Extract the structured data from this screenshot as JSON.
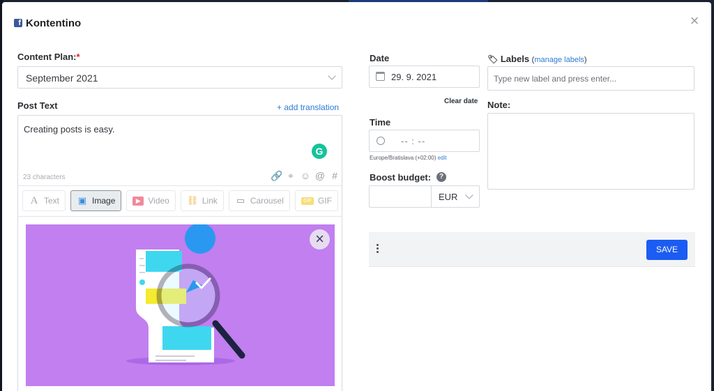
{
  "header": {
    "title": "Kontentino",
    "network_icon": "facebook-icon",
    "close_icon": "×"
  },
  "content_plan": {
    "label": "Content Plan:",
    "required_mark": "*",
    "value": "September 2021"
  },
  "post_text": {
    "label": "Post Text",
    "add_translation": "+ add translation",
    "value": "Creating posts is easy.",
    "char_count": "23 characters",
    "grammarly_letter": "G",
    "toolbar_icons": [
      "link-icon",
      "target-icon",
      "emoji-icon",
      "at-icon",
      "hashtag-icon"
    ]
  },
  "media_tabs": [
    {
      "label": "Text",
      "icon": "A",
      "active": false
    },
    {
      "label": "Image",
      "icon": "▣",
      "active": true
    },
    {
      "label": "Video",
      "icon": "▶",
      "active": false
    },
    {
      "label": "Link",
      "icon": "⛓",
      "active": false
    },
    {
      "label": "Carousel",
      "icon": "▭",
      "active": false
    },
    {
      "label": "GIF",
      "icon": "GIF",
      "active": false
    }
  ],
  "image_preview": {
    "remove_icon": "×"
  },
  "date": {
    "label": "Date",
    "value": "29. 9. 2021",
    "clear_label": "Clear date"
  },
  "time": {
    "label": "Time",
    "value": "-- : --",
    "timezone": "Europe/Bratislava (+02:00)",
    "timezone_edit": "edit"
  },
  "boost": {
    "label": "Boost budget:",
    "help": "?",
    "amount": "",
    "currency": "EUR"
  },
  "labels": {
    "label": "Labels",
    "manage": "manage labels",
    "placeholder": "Type new label and press enter..."
  },
  "note": {
    "label": "Note:",
    "value": ""
  },
  "actions": {
    "save_label": "SAVE"
  },
  "colors": {
    "accent": "#1b5cf2",
    "image_bg": "#c17ff0",
    "link": "#2d7bd4",
    "required": "#e02020"
  }
}
